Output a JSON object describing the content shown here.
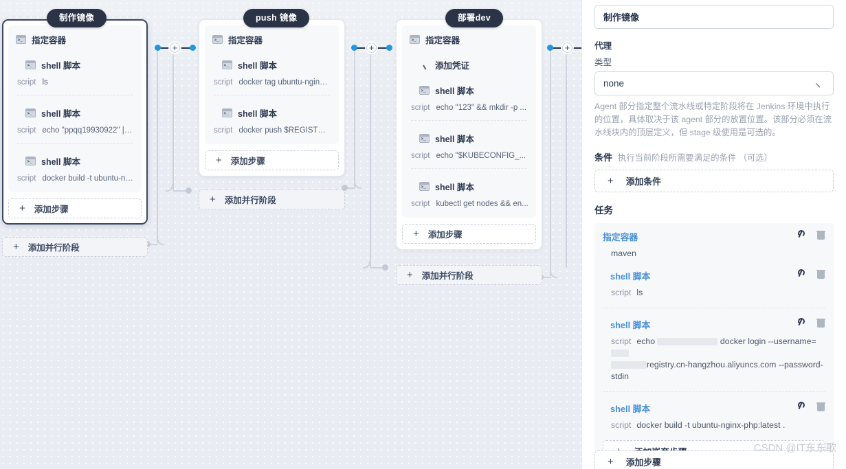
{
  "canvas": {
    "stages": [
      {
        "pill_label": "制作镜像",
        "selected": true,
        "root_step": {
          "icon": "terminal-icon",
          "label": "指定容器"
        },
        "steps": [
          {
            "icon": "terminal-icon",
            "label": "shell 脚本",
            "key": "script",
            "value": "ls"
          },
          {
            "icon": "terminal-icon",
            "label": "shell 脚本",
            "key": "script",
            "value": "echo \"ppqq19930922\" | doc..."
          },
          {
            "icon": "terminal-icon",
            "label": "shell 脚本",
            "key": "script",
            "value": "docker build -t ubuntu-ngin..."
          }
        ],
        "add_step_label": "添加步骤",
        "add_parallel_label": "添加并行阶段"
      },
      {
        "pill_label": "push 镜像",
        "selected": false,
        "root_step": {
          "icon": "terminal-icon",
          "label": "指定容器"
        },
        "steps": [
          {
            "icon": "terminal-icon",
            "label": "shell 脚本",
            "key": "script",
            "value": "docker tag ubuntu-nginx-ph..."
          },
          {
            "icon": "terminal-icon",
            "label": "shell 脚本",
            "key": "script",
            "value": "docker push $REGISTRY/$..."
          }
        ],
        "add_step_label": "添加步骤",
        "add_parallel_label": "添加并行阶段"
      },
      {
        "pill_label": "部署dev",
        "selected": false,
        "root_step": {
          "icon": "terminal-icon",
          "label": "指定容器"
        },
        "credential_step": {
          "icon": "key-icon",
          "label": "添加凭证"
        },
        "steps": [
          {
            "icon": "terminal-icon",
            "label": "shell 脚本",
            "key": "script",
            "value": "echo \"123\" && mkdir -p ..."
          },
          {
            "icon": "terminal-icon",
            "label": "shell 脚本",
            "key": "script",
            "value": "echo \"$KUBECONFIG_..."
          },
          {
            "icon": "terminal-icon",
            "label": "shell 脚本",
            "key": "script",
            "value": "kubectl get nodes && en..."
          }
        ],
        "add_step_label": "添加步骤",
        "add_parallel_label": "添加并行阶段"
      }
    ]
  },
  "panel": {
    "name_value": "制作镜像",
    "agent_title": "代理",
    "type_label": "类型",
    "type_value": "none",
    "agent_help": "Agent 部分指定整个流水线或特定阶段将在 Jenkins 环境中执行的位置，具体取决于该 agent 部分的放置位置。该部分必须在流水线块内的顶层定义，但 stage 级使用是可选的。",
    "condition_title": "条件",
    "condition_note": "执行当前阶段所需要满足的条件 （可选）",
    "add_condition_label": "添加条件",
    "tasks_title": "任务",
    "tasks": [
      {
        "title": "指定容器",
        "value_key": "",
        "value": "maven",
        "indent": false
      },
      {
        "title": "shell 脚本",
        "value_key": "script",
        "value": "ls",
        "indent": true
      },
      {
        "title": "shell 脚本",
        "value_key": "script",
        "value": "echo ▮▮▮▮▮▮▮▮ docker login --username=▮▮▮ ▮▮▮▮ registry.cn-hangzhou.aliyuncs.com --password-stdin",
        "indent": true,
        "redacted": true
      },
      {
        "title": "shell 脚本",
        "value_key": "script",
        "value": "docker build -t ubuntu-nginx-php:latest .",
        "indent": true
      }
    ],
    "add_nested_step_label": "添加嵌套步骤",
    "add_step_label": "添加步骤",
    "icons": {
      "wrench": "wrench-icon",
      "trash": "trash-icon",
      "chevron": "chevron-down-icon"
    }
  },
  "watermark": "CSDN @IT东东歌"
}
